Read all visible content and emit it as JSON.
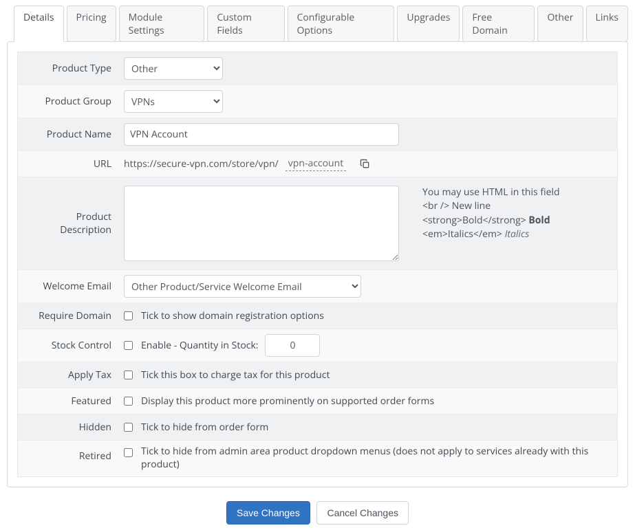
{
  "tabs": {
    "details": "Details",
    "pricing": "Pricing",
    "module_settings": "Module Settings",
    "custom_fields": "Custom Fields",
    "configurable_options": "Configurable Options",
    "upgrades": "Upgrades",
    "free_domain": "Free Domain",
    "other": "Other",
    "links": "Links",
    "active": "details"
  },
  "labels": {
    "product_type": "Product Type",
    "product_group": "Product Group",
    "product_name": "Product Name",
    "url": "URL",
    "product_description": "Product Description",
    "welcome_email": "Welcome Email",
    "require_domain": "Require Domain",
    "stock_control": "Stock Control",
    "apply_tax": "Apply Tax",
    "featured": "Featured",
    "hidden": "Hidden",
    "retired": "Retired"
  },
  "fields": {
    "product_type": "Other",
    "product_group": "VPNs",
    "product_name": "VPN Account",
    "url_base": "https://secure-vpn.com/store/vpn/",
    "url_slug": "vpn-account",
    "product_description": "",
    "welcome_email": "Other Product/Service Welcome Email",
    "stock_qty": "0"
  },
  "hints": {
    "desc_line1": "You may use HTML in this field",
    "desc_line2_prefix": "<br />",
    "desc_line2_text": " New line",
    "desc_line3_prefix": "<strong>Bold</strong>",
    "desc_line3_bold": " Bold",
    "desc_line4_prefix": "<em>Italics</em>",
    "desc_line4_italic": " Italics"
  },
  "checkbox_texts": {
    "require_domain": "Tick to show domain registration options",
    "stock_control": "Enable - Quantity in Stock:",
    "apply_tax": "Tick this box to charge tax for this product",
    "featured": "Display this product more prominently on supported order forms",
    "hidden": "Tick to hide from order form",
    "retired": "Tick to hide from admin area product dropdown menus (does not apply to services already with this product)"
  },
  "buttons": {
    "save": "Save Changes",
    "cancel": "Cancel Changes"
  }
}
